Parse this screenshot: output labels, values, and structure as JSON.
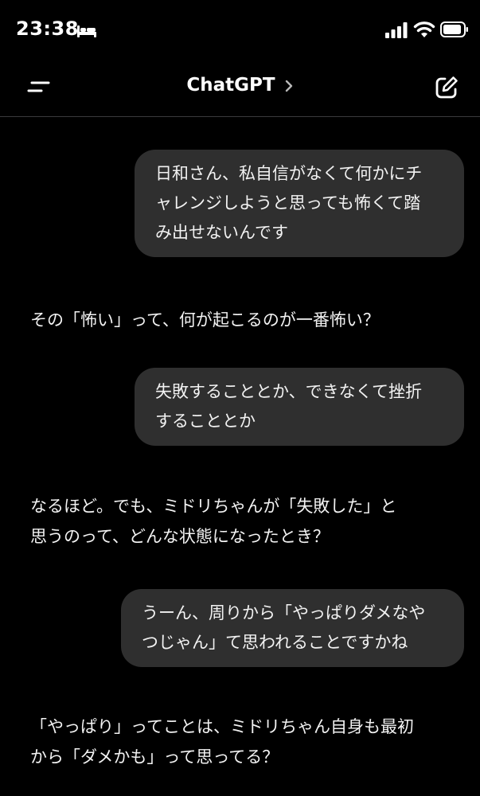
{
  "status_bar": {
    "time": "23:38",
    "icons": [
      "bed-icon",
      "cellular-signal-icon",
      "wifi-icon",
      "battery-icon"
    ]
  },
  "header": {
    "title": "ChatGPT",
    "icons": [
      "menu-icon",
      "chevron-right-icon",
      "new-chat-icon"
    ]
  },
  "messages": [
    {
      "role": "user",
      "lines": [
        "日和さん、私自信がなくて何かにチ",
        "ャレンジしようと思っても怖くて踏",
        "み出せないんです"
      ]
    },
    {
      "role": "assistant",
      "lines": [
        "その「怖い」って、何が起こるのが一番怖い？"
      ]
    },
    {
      "role": "user",
      "lines": [
        "失敗することとか、できなくて挫折",
        "することとか"
      ]
    },
    {
      "role": "assistant",
      "lines": [
        "なるほど。でも、ミドリちゃんが「失敗した」と",
        "思うのって、どんな状態になったとき？"
      ]
    },
    {
      "role": "user",
      "lines": [
        "うーん、周りから「やっぱりダメなや",
        "つじゃん」て思われることですかね"
      ]
    },
    {
      "role": "assistant",
      "lines": [
        "「やっぱり」ってことは、ミドリちゃん自身も最初",
        "から「ダメかも」って思ってる？"
      ]
    }
  ],
  "colors": {
    "background": "#000000",
    "user_bubble": "#2f2f2f",
    "text": "#f2f2f2",
    "divider": "#3a3a3c"
  }
}
